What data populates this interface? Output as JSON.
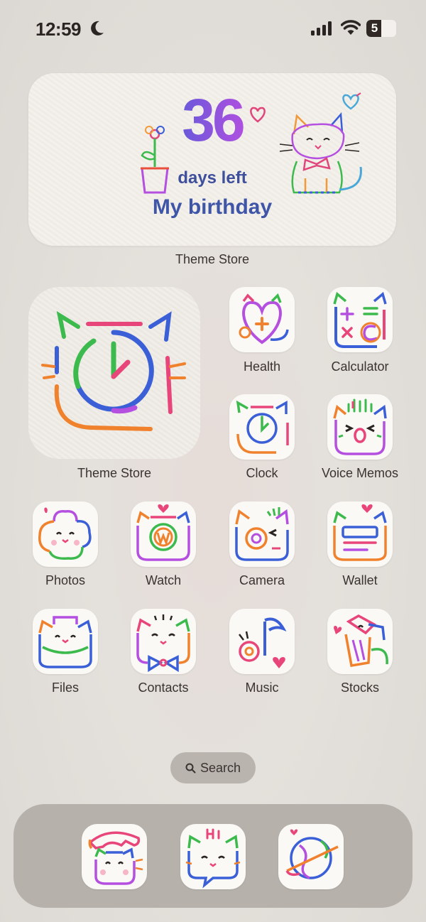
{
  "status_bar": {
    "time": "12:59",
    "battery_level": "5",
    "battery_fraction": 0.05,
    "icons": [
      "moon-icon",
      "cellular-signal-icon",
      "wifi-icon",
      "battery-icon"
    ]
  },
  "widget": {
    "count": "36",
    "days_text": "days left",
    "event_text": "My birthday",
    "label": "Theme Store"
  },
  "large_icon": {
    "label": "Theme Store",
    "icon": "clock-cat-icon"
  },
  "apps": [
    {
      "label": "Health",
      "icon": "heart-cat-icon"
    },
    {
      "label": "Calculator",
      "icon": "calculator-cat-icon"
    },
    {
      "label": "Clock",
      "icon": "clock-cat-icon"
    },
    {
      "label": "Voice Memos",
      "icon": "voice-memo-cat-icon"
    },
    {
      "label": "Photos",
      "icon": "flower-cat-icon"
    },
    {
      "label": "Watch",
      "icon": "watch-cat-icon"
    },
    {
      "label": "Camera",
      "icon": "camera-cat-icon"
    },
    {
      "label": "Wallet",
      "icon": "wallet-cat-icon"
    },
    {
      "label": "Files",
      "icon": "folder-cat-icon"
    },
    {
      "label": "Contacts",
      "icon": "bowtie-cat-icon"
    },
    {
      "label": "Music",
      "icon": "music-note-icon"
    },
    {
      "label": "Stocks",
      "icon": "chart-cat-icon"
    }
  ],
  "search": {
    "label": "Search"
  },
  "dock": [
    {
      "icon": "phone-cat-icon"
    },
    {
      "icon": "messages-cat-icon"
    },
    {
      "icon": "globe-icon"
    }
  ],
  "colors": {
    "background": "#e4e0db",
    "dock": "#b6b1ab",
    "text": "#3a3330",
    "widget_text": "#3e55a8"
  }
}
